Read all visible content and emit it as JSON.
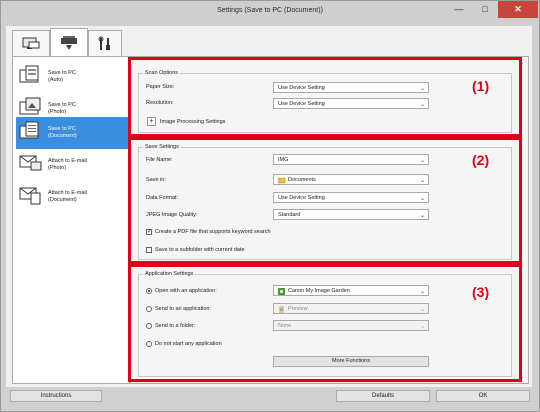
{
  "window": {
    "title": "Settings (Save to PC (Document))"
  },
  "tabs": [
    {
      "name": "scan-from-computer",
      "icon": "computer-scan-icon"
    },
    {
      "name": "scan-from-operation-panel",
      "icon": "scanner-icon"
    },
    {
      "name": "general-settings",
      "icon": "tools-icon"
    }
  ],
  "left_items": [
    {
      "label": "Save to PC\n(Auto)",
      "icon": "auto-doc-icon",
      "selected": false
    },
    {
      "label": "Save to PC\n(Photo)",
      "icon": "photo-doc-icon",
      "selected": false
    },
    {
      "label": "Save to PC\n(Document)",
      "icon": "document-icon",
      "selected": true
    },
    {
      "label": "Attach to E-mail\n(Photo)",
      "icon": "email-photo-icon",
      "selected": false
    },
    {
      "label": "Attach to E-mail\n(Document)",
      "icon": "email-document-icon",
      "selected": false
    }
  ],
  "scan_options": {
    "title": "Scan Options",
    "paper_size_label": "Paper Size:",
    "paper_size_value": "Use Device Setting",
    "resolution_label": "Resolution:",
    "resolution_value": "Use Device Setting",
    "image_processing_label": "Image Processing Settings"
  },
  "save_settings": {
    "title": "Save Settings",
    "file_name_label": "File Name:",
    "file_name_value": "IMG",
    "save_in_label": "Save in:",
    "save_in_value": "Documents",
    "data_format_label": "Data Format:",
    "data_format_value": "Use Device Setting",
    "jpeg_quality_label": "JPEG Image Quality:",
    "jpeg_quality_value": "Standard",
    "pdf_keyword_label": "Create a PDF file that supports keyword search",
    "pdf_keyword_checked": true,
    "subfolder_label": "Save to a subfolder with current date",
    "subfolder_checked": false
  },
  "application_settings": {
    "title": "Application Settings",
    "open_app_label": "Open with an application:",
    "open_app_value": "Canon My Image Garden",
    "send_app_label": "Send to an application:",
    "send_app_value": "Preview",
    "send_folder_label": "Send to a folder:",
    "send_folder_value": "None",
    "no_app_label": "Do not start any application",
    "more_functions_label": "More Functions",
    "selected_option": "open_with_application"
  },
  "annotations": {
    "label_1": "(1)",
    "label_2": "(2)",
    "label_3": "(3)",
    "color": "#e0001a"
  },
  "footer": {
    "instructions_label": "Instructions",
    "defaults_label": "Defaults",
    "ok_label": "OK"
  }
}
